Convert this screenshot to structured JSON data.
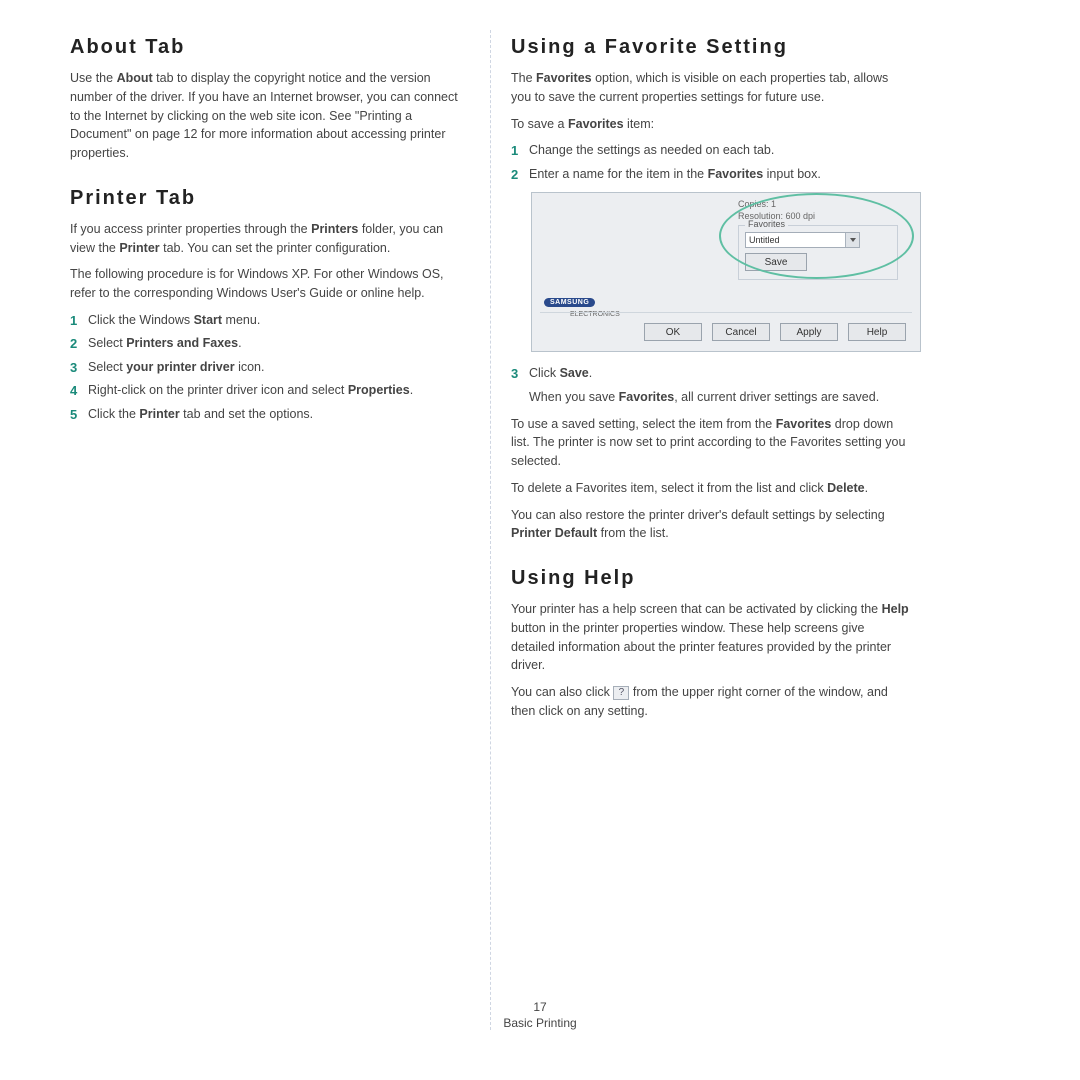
{
  "left": {
    "about": {
      "title": "About Tab",
      "p1a": "Use the ",
      "p1b": "About",
      "p1c": " tab to display the copyright notice and the version number of the driver. If you have an Internet browser, you can connect to the Internet by clicking on the web site icon. See \"Printing a Document\" on page 12 for more information about accessing printer properties."
    },
    "printer": {
      "title": "Printer Tab",
      "p1a": "If you access printer properties through the ",
      "p1b": "Printers",
      "p1c": " folder, you can view the ",
      "p1d": "Printer",
      "p1e": " tab. You can set the printer configuration.",
      "p2": "The following procedure is for Windows XP. For other Windows OS, refer to the corresponding Windows User's Guide or online help.",
      "steps": {
        "s1a": "Click the Windows ",
        "s1b": "Start",
        "s1c": " menu.",
        "s2a": "Select ",
        "s2b": "Printers and Faxes",
        "s2c": ".",
        "s3a": "Select ",
        "s3b": "your printer driver",
        "s3c": " icon.",
        "s4a": "Right-click on the printer driver icon and select ",
        "s4b": "Properties",
        "s4c": ".",
        "s5a": "Click the ",
        "s5b": "Printer",
        "s5c": " tab and set the options."
      }
    }
  },
  "right": {
    "fav": {
      "title": "Using a Favorite Setting",
      "p1a": "The ",
      "p1b": "Favorites",
      "p1c": " option, which is visible on each properties tab, allows you to save the current properties settings for future use.",
      "p2a": "To save a ",
      "p2b": "Favorites",
      "p2c": " item:",
      "s1": "Change the settings as needed on each tab.",
      "s2a": "Enter a name for the item in the ",
      "s2b": "Favorites",
      "s2c": " input box.",
      "s3a": "Click ",
      "s3b": "Save",
      "s3c": ".",
      "s3da": "When you save ",
      "s3db": "Favorites",
      "s3dc": ", all current driver settings are saved.",
      "p3a": "To use a saved setting, select the item from the ",
      "p3b": "Favorites",
      "p3c": " drop down list. The printer is now set to print according to the Favorites setting you selected.",
      "p4a": "To delete a Favorites item, select it from the list and click ",
      "p4b": "Delete",
      "p4c": ".",
      "p5a": "You can also restore the printer driver's default settings by selecting ",
      "p5b": "Printer Default",
      "p5c": " from the list."
    },
    "help": {
      "title": "Using Help",
      "p1a": "Your printer has a help screen that can be activated by clicking the ",
      "p1b": "Help",
      "p1c": " button in the printer properties window. These help screens give detailed information about the printer features provided by the printer driver.",
      "p2a": "You can also click ",
      "p2b": " from the upper right corner of the window, and then click on any setting."
    }
  },
  "shot": {
    "copies": "Copies: 1",
    "resolution": "Resolution: 600 dpi",
    "fav_legend": "Favorites",
    "fav_value": "Untitled",
    "save": "Save",
    "brand": "SAMSUNG",
    "brand_sub": "ELECTRONICS",
    "ok": "OK",
    "cancel": "Cancel",
    "apply": "Apply",
    "help": "Help"
  },
  "footer": {
    "page": "17",
    "section": "Basic Printing"
  }
}
